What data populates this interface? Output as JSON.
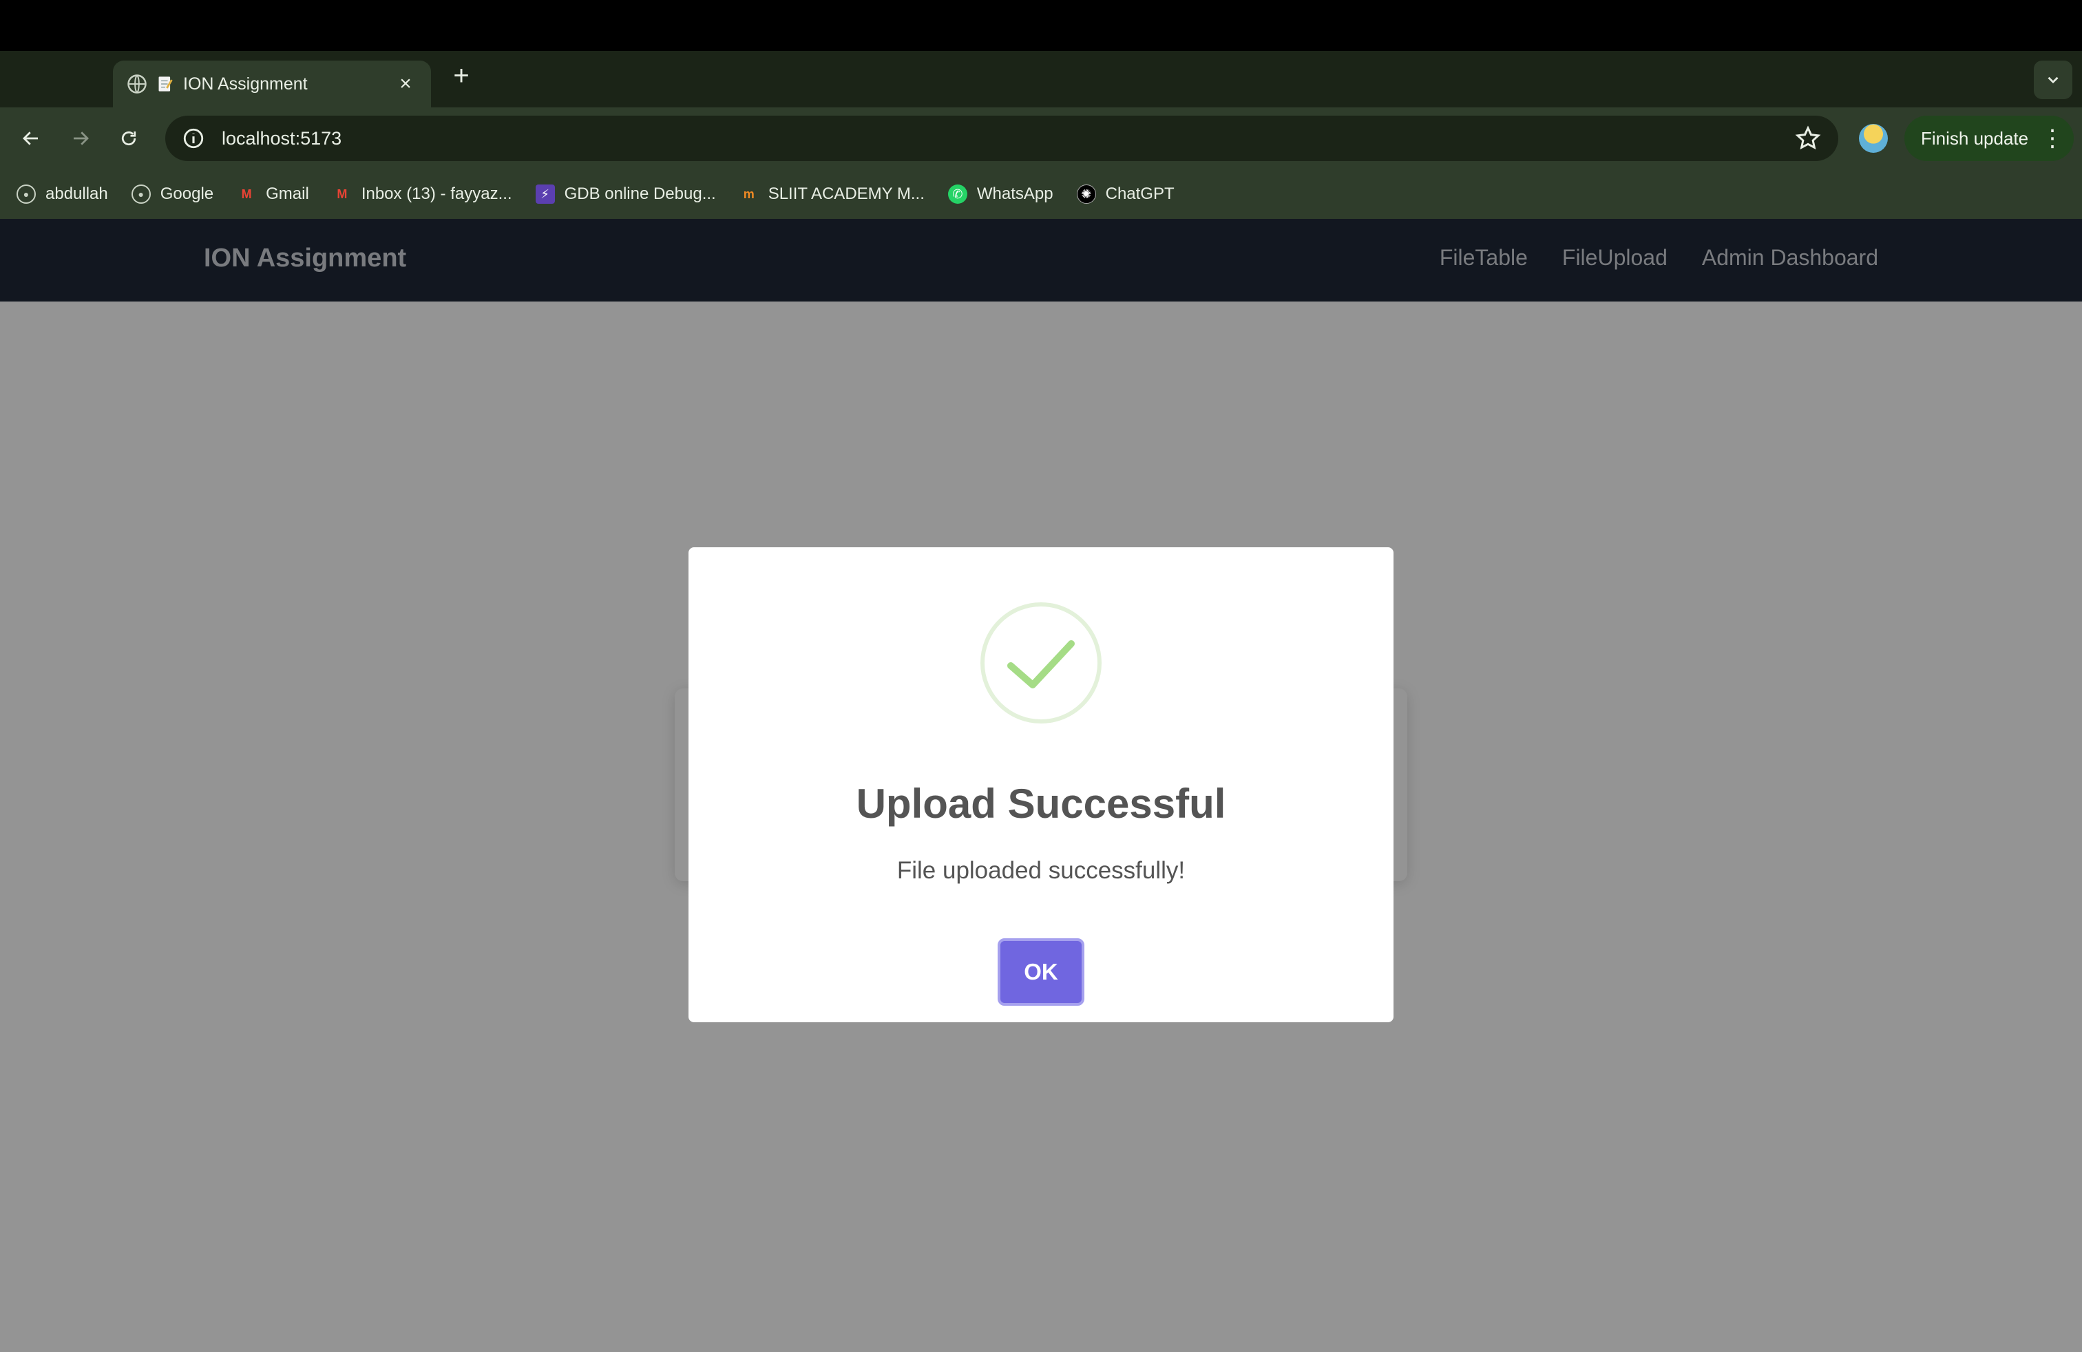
{
  "browser": {
    "tab": {
      "title": "ION Assignment"
    },
    "address_bar": {
      "url": "localhost:5173"
    },
    "finish_update_label": "Finish update",
    "bookmarks": [
      {
        "label": "abdullah",
        "icon": "globe-icon"
      },
      {
        "label": "Google",
        "icon": "globe-icon"
      },
      {
        "label": "Gmail",
        "icon": "gmail-icon"
      },
      {
        "label": "Inbox (13) - fayyaz...",
        "icon": "gmail-icon"
      },
      {
        "label": "GDB online Debug...",
        "icon": "gdb-icon"
      },
      {
        "label": "SLIIT ACADEMY M...",
        "icon": "sliit-icon"
      },
      {
        "label": "WhatsApp",
        "icon": "whatsapp-icon"
      },
      {
        "label": "ChatGPT",
        "icon": "chatgpt-icon"
      }
    ]
  },
  "app": {
    "brand": "ION Assignment",
    "nav": [
      {
        "label": "FileTable"
      },
      {
        "label": "FileUpload"
      },
      {
        "label": "Admin Dashboard"
      }
    ]
  },
  "modal": {
    "title": "Upload Successful",
    "message": "File uploaded successfully!",
    "confirm_label": "OK",
    "icon": "success-check-icon"
  },
  "colors": {
    "app_nav_bg": "#1f2937",
    "confirm_button": "#7066e0",
    "success_check": "#a5dc86"
  }
}
